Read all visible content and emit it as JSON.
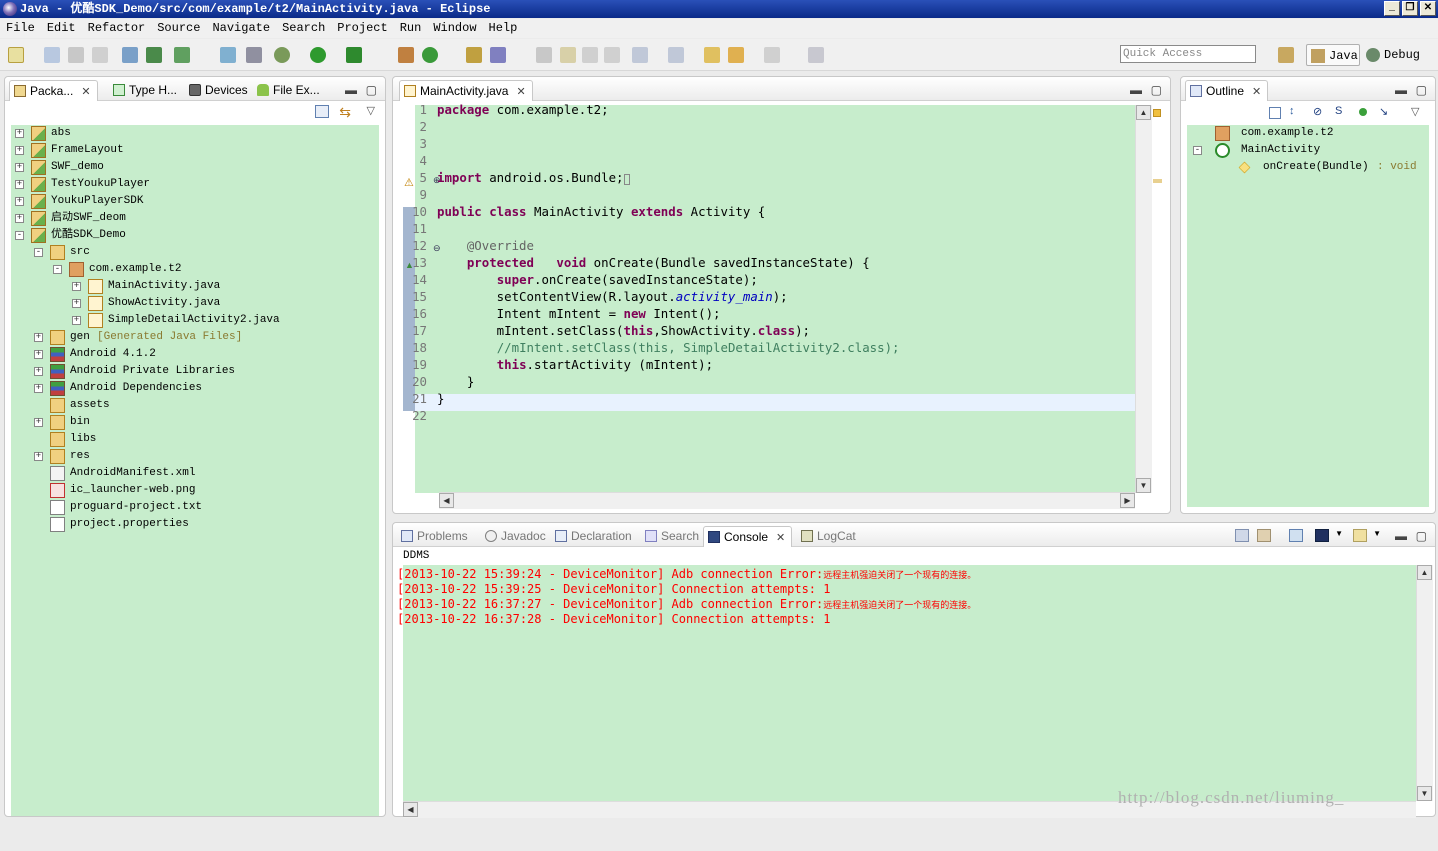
{
  "window": {
    "title": "Java - 优酷SDK_Demo/src/com/example/t2/MainActivity.java - Eclipse"
  },
  "menu": [
    "File",
    "Edit",
    "Refactor",
    "Source",
    "Navigate",
    "Search",
    "Project",
    "Run",
    "Window",
    "Help"
  ],
  "toolbar": {
    "quick_access_placeholder": "Quick Access",
    "perspective_java": "Java",
    "perspective_debug": "Debug"
  },
  "left_tabs": [
    {
      "label": "Packa...",
      "icon": "package-explorer-icon"
    },
    {
      "label": "Type H...",
      "icon": "type-hierarchy-icon"
    },
    {
      "label": "Devices",
      "icon": "device-icon"
    },
    {
      "label": "File Ex...",
      "icon": "android-icon"
    }
  ],
  "explorer": [
    {
      "label": "abs",
      "depth": 0,
      "expander": "+",
      "icon": "android-project-icon"
    },
    {
      "label": "FrameLayout",
      "depth": 0,
      "expander": "+",
      "icon": "android-project-icon"
    },
    {
      "label": "SWF_demo",
      "depth": 0,
      "expander": "+",
      "icon": "android-project-icon"
    },
    {
      "label": "TestYoukuPlayer",
      "depth": 0,
      "expander": "+",
      "icon": "android-project-icon"
    },
    {
      "label": "YoukuPlayerSDK",
      "depth": 0,
      "expander": "+",
      "icon": "android-project-icon"
    },
    {
      "label": "启动SWF_deom",
      "depth": 0,
      "expander": "+",
      "icon": "android-project-icon"
    },
    {
      "label": "优酷SDK_Demo",
      "depth": 0,
      "expander": "-",
      "icon": "android-project-icon"
    },
    {
      "label": "src",
      "depth": 1,
      "expander": "-",
      "icon": "source-folder-icon"
    },
    {
      "label": "com.example.t2",
      "depth": 2,
      "expander": "-",
      "icon": "package-icon"
    },
    {
      "label": "MainActivity.java",
      "depth": 3,
      "expander": "+",
      "icon": "java-file-icon"
    },
    {
      "label": "ShowActivity.java",
      "depth": 3,
      "expander": "+",
      "icon": "java-file-icon"
    },
    {
      "label": "SimpleDetailActivity2.java",
      "depth": 3,
      "expander": "+",
      "icon": "java-file-icon"
    },
    {
      "label": "gen",
      "suffix": "[Generated Java Files]",
      "depth": 1,
      "expander": "+",
      "icon": "source-folder-icon"
    },
    {
      "label": "Android 4.1.2",
      "depth": 1,
      "expander": "+",
      "icon": "library-icon"
    },
    {
      "label": "Android Private Libraries",
      "depth": 1,
      "expander": "+",
      "icon": "library-icon"
    },
    {
      "label": "Android Dependencies",
      "depth": 1,
      "expander": "+",
      "icon": "library-icon"
    },
    {
      "label": "assets",
      "depth": 1,
      "expander": "",
      "icon": "folder-icon"
    },
    {
      "label": "bin",
      "depth": 1,
      "expander": "+",
      "icon": "folder-icon"
    },
    {
      "label": "libs",
      "depth": 1,
      "expander": "",
      "icon": "folder-icon"
    },
    {
      "label": "res",
      "depth": 1,
      "expander": "+",
      "icon": "folder-icon"
    },
    {
      "label": "AndroidManifest.xml",
      "depth": 1,
      "expander": "",
      "icon": "xml-file-icon"
    },
    {
      "label": "ic_launcher-web.png",
      "depth": 1,
      "expander": "",
      "icon": "png-file-icon"
    },
    {
      "label": "proguard-project.txt",
      "depth": 1,
      "expander": "",
      "icon": "text-file-icon"
    },
    {
      "label": "project.properties",
      "depth": 1,
      "expander": "",
      "icon": "text-file-icon"
    }
  ],
  "editor": {
    "tab": "MainActivity.java",
    "lines": [
      {
        "n": "1",
        "html": "<span class='kw'>package</span> com.example.t2;"
      },
      {
        "n": "2",
        "html": ""
      },
      {
        "n": "3",
        "html": ""
      },
      {
        "n": "4",
        "html": ""
      },
      {
        "n": "5",
        "html": "<span class='kw'>import</span> android.os.Bundle;<span style='border:1px solid #888;font-size:8px'>&nbsp;</span>"
      },
      {
        "n": "9",
        "html": ""
      },
      {
        "n": "10",
        "html": "<span class='kw'>public class</span> MainActivity <span class='kw'>extends</span> Activity {"
      },
      {
        "n": "11",
        "html": ""
      },
      {
        "n": "12",
        "html": "    <span class='ann'>@Override</span>"
      },
      {
        "n": "13",
        "html": "    <span class='kw'>protected</span>   <span class='kw'>void</span> onCreate(Bundle savedInstanceState) {"
      },
      {
        "n": "14",
        "html": "        <span class='kw'>super</span>.onCreate(savedInstanceState);"
      },
      {
        "n": "15",
        "html": "        setContentView(R.layout.<span class='fld'>activity_main</span>);"
      },
      {
        "n": "16",
        "html": "        Intent mIntent = <span class='kw'>new</span> Intent();"
      },
      {
        "n": "17",
        "html": "        mIntent.setClass(<span class='kw'>this</span>,ShowActivity.<span class='kw'>class</span>);"
      },
      {
        "n": "18",
        "html": "        <span class='cmt'>//mIntent.setClass(this, SimpleDetailActivity2.class);</span>"
      },
      {
        "n": "19",
        "html": "        <span class='kw'>this</span>.startActivity (mIntent);"
      },
      {
        "n": "20",
        "html": "    }"
      },
      {
        "n": "21",
        "html": "}"
      },
      {
        "n": "22",
        "html": ""
      }
    ]
  },
  "outline": {
    "tab": "Outline",
    "items": [
      {
        "label": "com.example.t2",
        "depth": 0,
        "expander": "",
        "icon": "package-icon"
      },
      {
        "label": "MainActivity",
        "depth": 0,
        "expander": "-",
        "icon": "class-icon"
      },
      {
        "label": "onCreate(Bundle)",
        "suffix": " : void",
        "depth": 1,
        "expander": "",
        "icon": "method-icon"
      }
    ]
  },
  "bottom_tabs": [
    {
      "label": "Problems",
      "active": false
    },
    {
      "label": "Javadoc",
      "active": false
    },
    {
      "label": "Declaration",
      "active": false
    },
    {
      "label": "Search",
      "active": false
    },
    {
      "label": "Console",
      "active": true
    },
    {
      "label": "LogCat",
      "active": false
    }
  ],
  "console": {
    "name": "DDMS",
    "lines": [
      {
        "text": "[2013-10-22 15:39:24 - DeviceMonitor] Adb connection Error:",
        "cn": "远程主机强迫关闭了一个现有的连接。"
      },
      {
        "text": "[2013-10-22 15:39:25 - DeviceMonitor] Connection attempts: 1",
        "cn": ""
      },
      {
        "text": "[2013-10-22 16:37:27 - DeviceMonitor] Adb connection Error:",
        "cn": "远程主机强迫关闭了一个现有的连接。"
      },
      {
        "text": "[2013-10-22 16:37:28 - DeviceMonitor] Connection attempts: 1",
        "cn": ""
      }
    ]
  },
  "watermark": "http://blog.csdn.net/liuming_"
}
